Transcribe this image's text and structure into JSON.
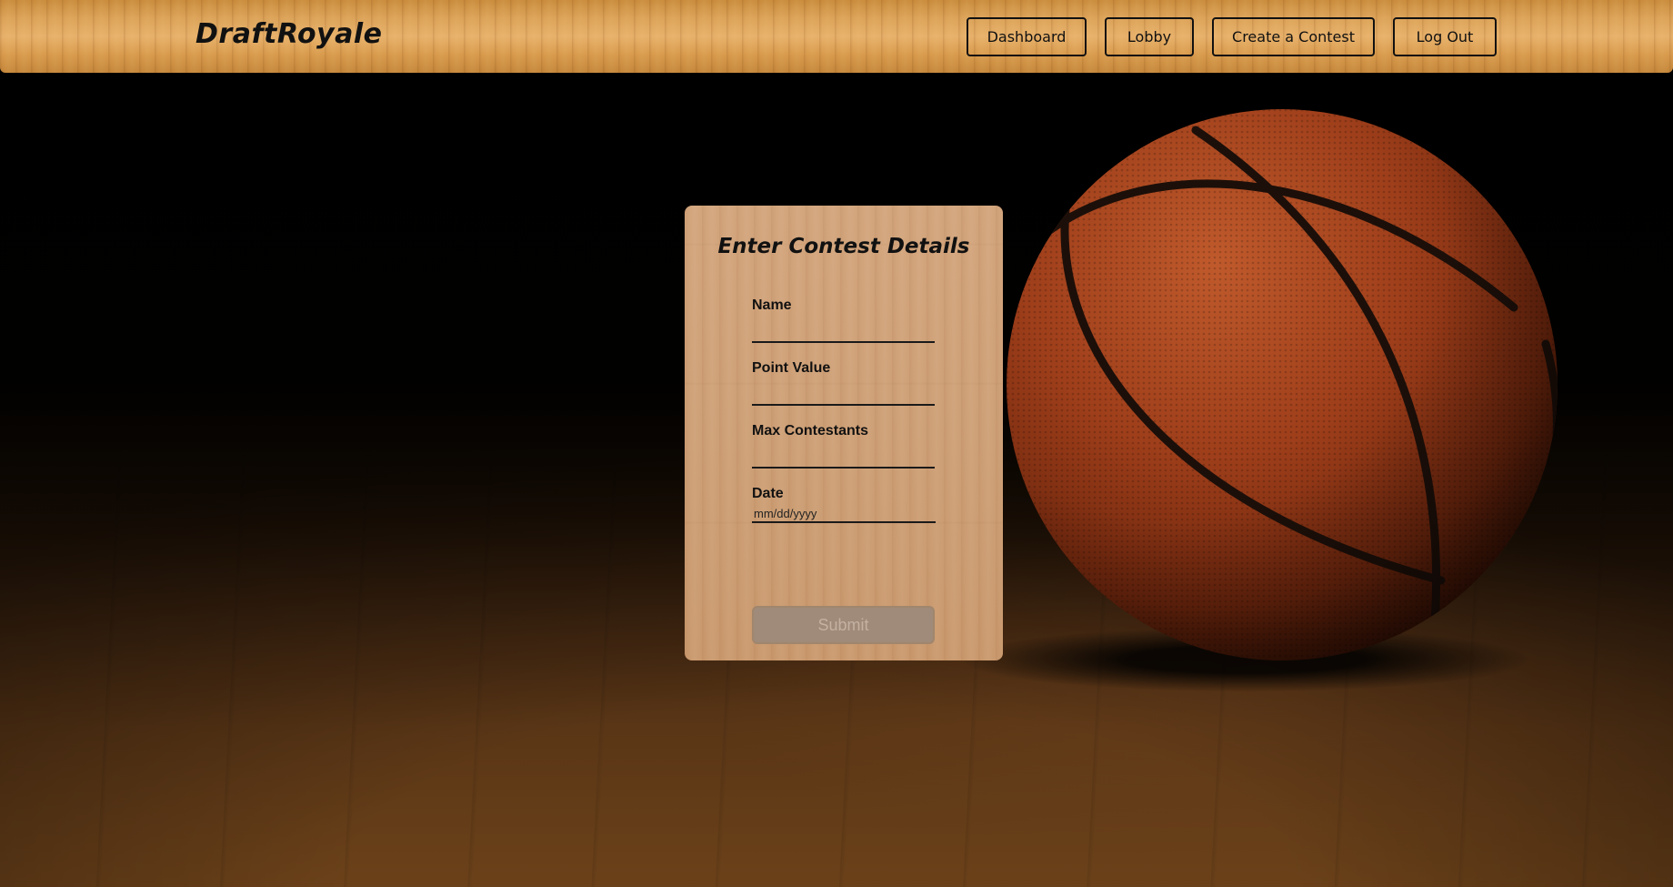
{
  "app": {
    "brand": "DraftRoyale"
  },
  "nav": {
    "items": [
      {
        "label": "Dashboard"
      },
      {
        "label": "Lobby"
      },
      {
        "label": "Create a Contest"
      },
      {
        "label": "Log Out"
      }
    ]
  },
  "form": {
    "title": "Enter Contest Details",
    "fields": [
      {
        "label": "Name",
        "value": ""
      },
      {
        "label": "Point Value",
        "value": ""
      },
      {
        "label": "Max Contestants",
        "value": ""
      },
      {
        "label": "Date",
        "placeholder": "mm/dd/yyyy"
      }
    ],
    "submit_label": "Submit",
    "submit_disabled": true
  },
  "colors": {
    "header_wood": "#dba258",
    "card_wood": "#cd9f76",
    "ball_orange": "#a8461f",
    "submit_disabled_bg": "#a08a79"
  }
}
